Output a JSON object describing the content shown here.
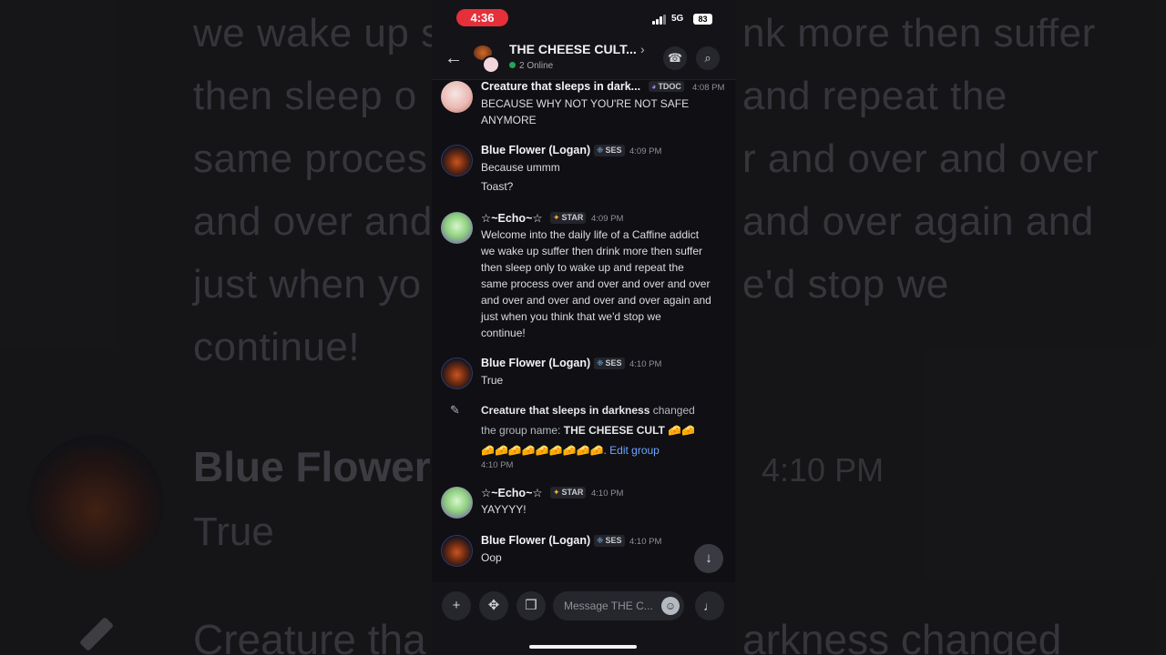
{
  "background": {
    "lines": [
      "we wake up s",
      "then sleep o",
      "same proces",
      "and over and",
      "just when yo",
      "continue!"
    ],
    "lines_right": [
      "nk more then suffer",
      "and repeat the",
      "r and over and over",
      "and over again and",
      "e'd stop we"
    ],
    "name": "Blue Flower",
    "time": "4:10 PM",
    "true_text": "True",
    "bottom_left": "Creature tha",
    "bottom_right": "arkness changed"
  },
  "status": {
    "time": "4:36",
    "network": "5G",
    "battery": "83"
  },
  "header": {
    "back_icon": "←",
    "group_name": "THE CHEESE CULT...",
    "chevron": "›",
    "online": "2 Online"
  },
  "messages": [
    {
      "author": "Creature that sleeps in dark...",
      "tag": "TDOC",
      "tag_glyph": "◕",
      "time": "4:08 PM",
      "lines": [
        "BECAUSE WHY NOT YOU'RE NOT SAFE",
        "ANYMORE"
      ]
    },
    {
      "author": "Blue Flower (Logan)",
      "tag": "SES",
      "tag_glyph": "❈",
      "time": "4:09 PM",
      "lines": [
        "Because ummm"
      ],
      "extra": "Toast?"
    },
    {
      "author": "☆~Echo~☆",
      "tag": "STAR",
      "tag_glyph": "✦",
      "time": "4:09 PM",
      "lines": [
        "Welcome into the daily life of a Caffine addict",
        "we wake up suffer then drink more then suffer",
        "then sleep only to wake up and repeat the",
        "same process over and over and over and over",
        "and over and over and over and over again and",
        "just when you think that we'd stop we",
        "continue!"
      ]
    },
    {
      "author": "Blue Flower (Logan)",
      "tag": "SES",
      "tag_glyph": "❈",
      "time": "4:10 PM",
      "lines": [
        "True"
      ]
    },
    {
      "author": "☆~Echo~☆",
      "tag": "STAR",
      "tag_glyph": "✦",
      "time": "4:10 PM",
      "lines": [
        "YAYYYY!"
      ]
    },
    {
      "author": "Blue Flower (Logan)",
      "tag": "SES",
      "tag_glyph": "❈",
      "time": "4:10 PM",
      "lines": [
        "Oop"
      ]
    }
  ],
  "system": {
    "actor": "Creature that sleeps in darkness",
    "action": " changed",
    "line2_prefix": "the group name: ",
    "new_name": "THE CHEESE CULT",
    "cheese_a": "🧀🧀",
    "cheese_b": "🧀🧀🧀🧀🧀🧀🧀🧀🧀",
    "period": ". ",
    "link": "Edit group",
    "time": "4:10 PM",
    "icon": "✎"
  },
  "composer": {
    "placeholder": "Message THE C...",
    "plus_icon": "+",
    "apps_icon": "✥",
    "gift_icon": "❒",
    "emoji_icon": "☺",
    "mic_icon": "♩"
  },
  "scroll_icon": "↓",
  "call_icon": "☎",
  "search_icon": "⌕"
}
